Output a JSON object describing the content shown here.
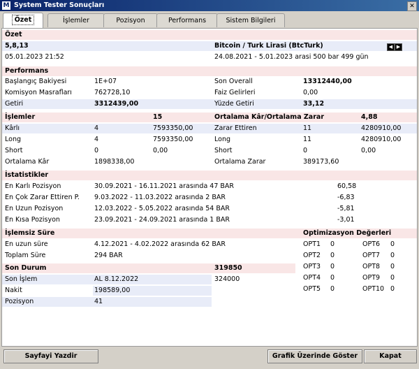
{
  "window": {
    "title": "System Tester Sonuçları",
    "icon": "M"
  },
  "tabs": [
    "Özet",
    "İşlemler",
    "Pozisyon",
    "Performans",
    "Sistem Bilgileri"
  ],
  "ozet": {
    "header": "Özet",
    "version": "5,8,13",
    "symbol": "Bitcoin / Turk Lirasi (BtcTurk)",
    "date": "05.01.2023 21:52",
    "range": "24.08.2021 - 5.01.2023 arasi 500 bar 499 gün"
  },
  "performans": {
    "header": "Performans",
    "rows": [
      {
        "l1": "Başlangıç Bakiyesi",
        "v1": "1E+07",
        "l2": "Son Overall",
        "v2": "13312440,00"
      },
      {
        "l1": "Komisyon Masrafları",
        "v1": "762728,10",
        "l2": "Faiz Gelirleri",
        "v2": "0,00"
      },
      {
        "l1": "Getiri",
        "v1": "3312439,00",
        "l2": "Yüzde Getiri",
        "v2": "33,12"
      }
    ]
  },
  "islemler": {
    "header": "İşlemler",
    "count": "15",
    "header2": "Ortalama Kâr/Ortalama Zarar",
    "ratio": "4,88",
    "rows": [
      {
        "l1": "Kârlı",
        "c1": "4",
        "v1": "7593350,00",
        "l2": "Zarar Ettiren",
        "c2": "11",
        "v2": "4280910,00"
      },
      {
        "l1": "Long",
        "c1": "4",
        "v1": "7593350,00",
        "l2": "Long",
        "c2": "11",
        "v2": "4280910,00"
      },
      {
        "l1": "Short",
        "c1": "0",
        "v1": "0,00",
        "l2": "Short",
        "c2": "0",
        "v2": "0,00"
      },
      {
        "l1": "Ortalama Kâr",
        "c1": "1898338,00",
        "v1": "",
        "l2": "Ortalama Zarar",
        "c2": "389173,60",
        "v2": ""
      }
    ]
  },
  "istatistikler": {
    "header": "İstatistikler",
    "rows": [
      {
        "label": "En Karlı Pozisyon",
        "desc": "30.09.2021 - 16.11.2021 arasında 47 BAR",
        "value": "60,58"
      },
      {
        "label": "En Çok Zarar Ettiren P.",
        "desc": "9.03.2022 - 11.03.2022 arasında 2 BAR",
        "value": "-6,83"
      },
      {
        "label": "En Uzun Pozisyon",
        "desc": "12.03.2022 - 5.05.2022 arasında 54 BAR",
        "value": "-5,81"
      },
      {
        "label": "En Kısa Pozisyon",
        "desc": "23.09.2021 - 24.09.2021 arasında 1 BAR",
        "value": "-3,01"
      }
    ]
  },
  "islemsiz": {
    "header": "İşlemsiz Süre",
    "rows": [
      {
        "label": "En uzun süre",
        "value": "4.12.2021 - 4.02.2022 arasında 62 BAR"
      },
      {
        "label": "Toplam Süre",
        "value": "294 BAR"
      }
    ]
  },
  "optimizasyon": {
    "header": "Optimizasyon Değerleri",
    "items": [
      {
        "name": "OPT1",
        "value": "0"
      },
      {
        "name": "OPT2",
        "value": "0"
      },
      {
        "name": "OPT3",
        "value": "0"
      },
      {
        "name": "OPT4",
        "value": "0"
      },
      {
        "name": "OPT5",
        "value": "0"
      },
      {
        "name": "OPT6",
        "value": "0"
      },
      {
        "name": "OPT7",
        "value": "0"
      },
      {
        "name": "OPT8",
        "value": "0"
      },
      {
        "name": "OPT9",
        "value": "0"
      },
      {
        "name": "OPT10",
        "value": "0"
      }
    ]
  },
  "sondurum": {
    "header": "Son Durum",
    "total": "319850",
    "rows": [
      {
        "label": "Son İşlem",
        "value": "AL  8.12.2022",
        "extra": "324000"
      },
      {
        "label": "Nakit",
        "value": "198589,00",
        "extra": ""
      },
      {
        "label": "Pozisyon",
        "value": "41",
        "extra": ""
      }
    ]
  },
  "buttons": {
    "print": "Sayfayi Yazdir",
    "chart": "Grafik Üzerinde Göster",
    "close": "Kapat"
  },
  "colors": {
    "title_bar": "#0a246a",
    "section_band": "#f9e6e6",
    "alt_row": "#e8ecf8"
  }
}
